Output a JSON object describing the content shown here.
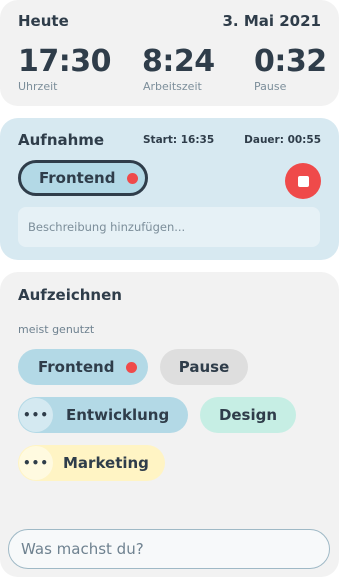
{
  "today": {
    "title": "Heute",
    "date": "3. Mai 2021",
    "clock": {
      "value": "17:30",
      "label": "Uhrzeit"
    },
    "worktime": {
      "value": "8:24",
      "label": "Arbeitszeit"
    },
    "pause": {
      "value": "0:32",
      "label": "Pause"
    }
  },
  "recording": {
    "title": "Aufnahme",
    "start": "Start: 16:35",
    "duration": "Dauer: 00:55",
    "active_tag": "Frontend",
    "description_placeholder": "Beschreibung hinzufügen..."
  },
  "track": {
    "title": "Aufzeichnen",
    "section": "meist genutzt",
    "tags": {
      "frontend": "Frontend",
      "pause": "Pause",
      "entwicklung": "Entwicklung",
      "design": "Design",
      "marketing": "Marketing"
    },
    "more_glyph": "•••"
  },
  "input": {
    "placeholder": "Was machst du?"
  },
  "colors": {
    "accent_red": "#ef4a4a",
    "recording_bg": "#d7e9f1",
    "card_bg": "#f2f2f2",
    "tag_blue": "#b3d9e6",
    "tag_gray": "#dedede",
    "tag_mint": "#c6eee4",
    "tag_yellow": "#fff4c4"
  },
  "icons": {
    "stop": "stop-icon",
    "recording_dot": "recording-dot-icon",
    "more": "more-dots-icon"
  }
}
